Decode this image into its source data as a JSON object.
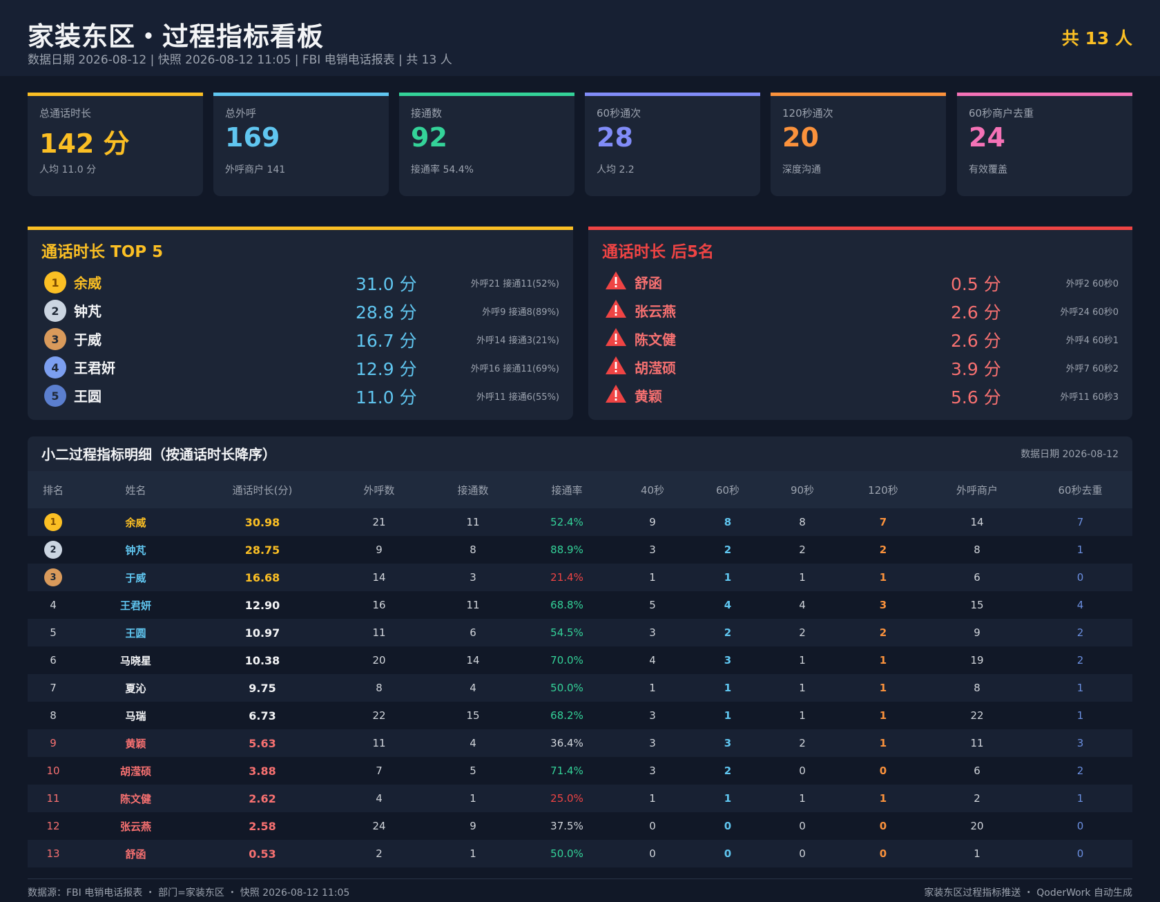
{
  "header": {
    "title": "家装东区・过程指标看板",
    "subtitle": "数据日期 2026-08-12 | 快照 2026-08-12 11:05 | FBI 电销电话报表 | 共 13 人",
    "count": "共 13 人"
  },
  "kpis": [
    {
      "label": "总通话时长",
      "value": "142 分",
      "sub": "人均 11.0 分",
      "color": "#fbbf24"
    },
    {
      "label": "总外呼",
      "value": "169",
      "sub": "外呼商户 141",
      "color": "#60c6f0"
    },
    {
      "label": "接通数",
      "value": "92",
      "sub": "接通率 54.4%",
      "color": "#34d399"
    },
    {
      "label": "60秒通次",
      "value": "28",
      "sub": "人均 2.2",
      "color": "#818cf8"
    },
    {
      "label": "120秒通次",
      "value": "20",
      "sub": "深度沟通",
      "color": "#fb923c"
    },
    {
      "label": "60秒商户去重",
      "value": "24",
      "sub": "有效覆盖",
      "color": "#f472b6"
    }
  ],
  "top5": {
    "title": "通话时长 TOP 5",
    "color": "#fbbf24",
    "items": [
      {
        "rank": "1",
        "name": "余威",
        "value": "31.0 分",
        "note": "外呼21 接通11(52%)",
        "badge_color": "#fbbf24",
        "name_color": "#fbbf24"
      },
      {
        "rank": "2",
        "name": "钟芃",
        "value": "28.8 分",
        "note": "外呼9 接通8(89%)",
        "badge_color": "#cbd5e1",
        "name_color": "#f3f4f6"
      },
      {
        "rank": "3",
        "name": "于威",
        "value": "16.7 分",
        "note": "外呼14 接通3(21%)",
        "badge_color": "#d99a5b",
        "name_color": "#f3f4f6"
      },
      {
        "rank": "4",
        "name": "王君妍",
        "value": "12.9 分",
        "note": "外呼16 接通11(69%)",
        "badge_color": "#7c9ff0",
        "name_color": "#f3f4f6"
      },
      {
        "rank": "5",
        "name": "王圆",
        "value": "11.0 分",
        "note": "外呼11 接通6(55%)",
        "badge_color": "#5b7fcf",
        "name_color": "#f3f4f6"
      }
    ]
  },
  "bottom5": {
    "title": "通话时长 后5名",
    "color": "#ef4444",
    "items": [
      {
        "name": "舒函",
        "value": "0.5 分",
        "note": "外呼2 60秒0"
      },
      {
        "name": "张云燕",
        "value": "2.6 分",
        "note": "外呼24 60秒0"
      },
      {
        "name": "陈文健",
        "value": "2.6 分",
        "note": "外呼4 60秒1"
      },
      {
        "name": "胡滢硕",
        "value": "3.9 分",
        "note": "外呼7 60秒2"
      },
      {
        "name": "黄颖",
        "value": "5.6 分",
        "note": "外呼11 60秒3"
      }
    ]
  },
  "table": {
    "title": "小二过程指标明细（按通话时长降序）",
    "date": "数据日期 2026-08-12",
    "columns": [
      "排名",
      "姓名",
      "通话时长(分)",
      "外呼数",
      "接通数",
      "接通率",
      "40秒",
      "60秒",
      "90秒",
      "120秒",
      "外呼商户",
      "60秒去重"
    ],
    "rows": [
      {
        "rank": "1",
        "name": "余威",
        "duration": "30.98",
        "calls": "21",
        "connected": "11",
        "rate": "52.4%",
        "s40": "9",
        "s60": "8",
        "s90": "8",
        "s120": "7",
        "merchants": "14",
        "dedup": "7",
        "tier": "top",
        "badge_color": "#fbbf24",
        "name_color": "#fbbf24",
        "dur_color": "#fbbf24",
        "rate_color": "#34d399"
      },
      {
        "rank": "2",
        "name": "钟芃",
        "duration": "28.75",
        "calls": "9",
        "connected": "8",
        "rate": "88.9%",
        "s40": "3",
        "s60": "2",
        "s90": "2",
        "s120": "2",
        "merchants": "8",
        "dedup": "1",
        "tier": "top",
        "badge_color": "#cbd5e1",
        "name_color": "#60c6f0",
        "dur_color": "#fbbf24",
        "rate_color": "#34d399"
      },
      {
        "rank": "3",
        "name": "于威",
        "duration": "16.68",
        "calls": "14",
        "connected": "3",
        "rate": "21.4%",
        "s40": "1",
        "s60": "1",
        "s90": "1",
        "s120": "1",
        "merchants": "6",
        "dedup": "0",
        "tier": "top",
        "badge_color": "#d99a5b",
        "name_color": "#60c6f0",
        "dur_color": "#fbbf24",
        "rate_color": "#ef4444"
      },
      {
        "rank": "4",
        "name": "王君妍",
        "duration": "12.90",
        "calls": "16",
        "connected": "11",
        "rate": "68.8%",
        "s40": "5",
        "s60": "4",
        "s90": "4",
        "s120": "3",
        "merchants": "15",
        "dedup": "4",
        "tier": "mid",
        "name_color": "#60c6f0",
        "dur_color": "#f3f4f6",
        "rate_color": "#34d399"
      },
      {
        "rank": "5",
        "name": "王圆",
        "duration": "10.97",
        "calls": "11",
        "connected": "6",
        "rate": "54.5%",
        "s40": "3",
        "s60": "2",
        "s90": "2",
        "s120": "2",
        "merchants": "9",
        "dedup": "2",
        "tier": "mid",
        "name_color": "#60c6f0",
        "dur_color": "#f3f4f6",
        "rate_color": "#34d399"
      },
      {
        "rank": "6",
        "name": "马晓星",
        "duration": "10.38",
        "calls": "20",
        "connected": "14",
        "rate": "70.0%",
        "s40": "4",
        "s60": "3",
        "s90": "1",
        "s120": "1",
        "merchants": "19",
        "dedup": "2",
        "tier": "mid",
        "name_color": "#f3f4f6",
        "dur_color": "#f3f4f6",
        "rate_color": "#34d399"
      },
      {
        "rank": "7",
        "name": "夏沁",
        "duration": "9.75",
        "calls": "8",
        "connected": "4",
        "rate": "50.0%",
        "s40": "1",
        "s60": "1",
        "s90": "1",
        "s120": "1",
        "merchants": "8",
        "dedup": "1",
        "tier": "mid",
        "name_color": "#f3f4f6",
        "dur_color": "#f3f4f6",
        "rate_color": "#34d399"
      },
      {
        "rank": "8",
        "name": "马瑞",
        "duration": "6.73",
        "calls": "22",
        "connected": "15",
        "rate": "68.2%",
        "s40": "3",
        "s60": "1",
        "s90": "1",
        "s120": "1",
        "merchants": "22",
        "dedup": "1",
        "tier": "mid",
        "name_color": "#f3f4f6",
        "dur_color": "#f3f4f6",
        "rate_color": "#34d399"
      },
      {
        "rank": "9",
        "name": "黄颖",
        "duration": "5.63",
        "calls": "11",
        "connected": "4",
        "rate": "36.4%",
        "s40": "3",
        "s60": "3",
        "s90": "2",
        "s120": "1",
        "merchants": "11",
        "dedup": "3",
        "tier": "low",
        "name_color": "#f87171",
        "dur_color": "#f87171",
        "rate_color": "#d1d5db"
      },
      {
        "rank": "10",
        "name": "胡滢硕",
        "duration": "3.88",
        "calls": "7",
        "connected": "5",
        "rate": "71.4%",
        "s40": "3",
        "s60": "2",
        "s90": "0",
        "s120": "0",
        "merchants": "6",
        "dedup": "2",
        "tier": "low",
        "name_color": "#f87171",
        "dur_color": "#f87171",
        "rate_color": "#34d399"
      },
      {
        "rank": "11",
        "name": "陈文健",
        "duration": "2.62",
        "calls": "4",
        "connected": "1",
        "rate": "25.0%",
        "s40": "1",
        "s60": "1",
        "s90": "1",
        "s120": "1",
        "merchants": "2",
        "dedup": "1",
        "tier": "low",
        "name_color": "#f87171",
        "dur_color": "#f87171",
        "rate_color": "#ef4444"
      },
      {
        "rank": "12",
        "name": "张云燕",
        "duration": "2.58",
        "calls": "24",
        "connected": "9",
        "rate": "37.5%",
        "s40": "0",
        "s60": "0",
        "s90": "0",
        "s120": "0",
        "merchants": "20",
        "dedup": "0",
        "tier": "low",
        "name_color": "#f87171",
        "dur_color": "#f87171",
        "rate_color": "#d1d5db"
      },
      {
        "rank": "13",
        "name": "舒函",
        "duration": "0.53",
        "calls": "2",
        "connected": "1",
        "rate": "50.0%",
        "s40": "0",
        "s60": "0",
        "s90": "0",
        "s120": "0",
        "merchants": "1",
        "dedup": "0",
        "tier": "low",
        "name_color": "#f87171",
        "dur_color": "#f87171",
        "rate_color": "#34d399"
      }
    ]
  },
  "footer": {
    "left": "数据源：FBI 电销电话报表 ・ 部门=家装东区 ・ 快照 2026-08-12 11:05",
    "right": "家装东区过程指标推送 ・ QoderWork 自动生成"
  },
  "colors": {
    "s60": "#60c6f0",
    "s120": "#fb923c",
    "dedup": "#6b8fe0",
    "low_rank": "#f87171",
    "bottom_value": "#f87171",
    "bottom_name": "#f87171",
    "warn": "#ef4444",
    "top_value": "#60c6f0"
  }
}
